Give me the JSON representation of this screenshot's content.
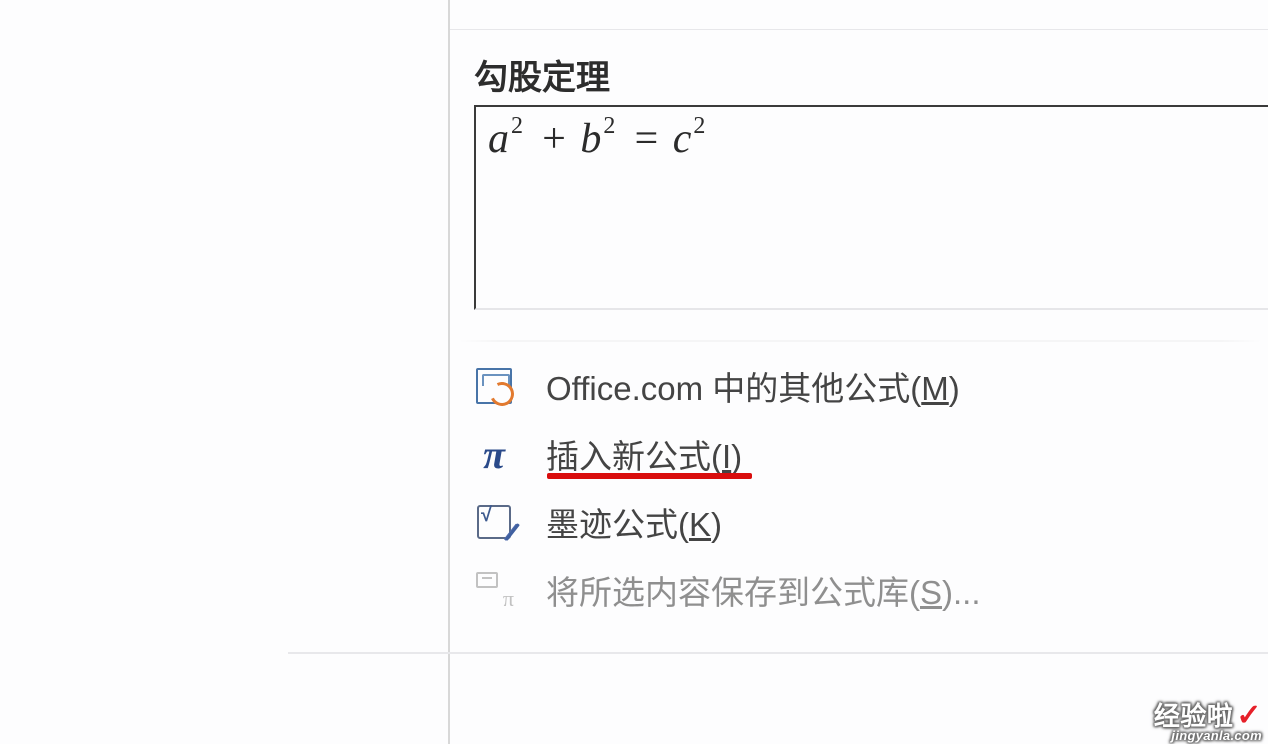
{
  "gallery": {
    "section_title": "勾股定理",
    "equation_html": "<i>a</i><sup>2</sup> + <i>b</i><sup>2</sup> = <i>c</i><sup>2</sup>"
  },
  "menu": {
    "office": {
      "label_pre": "Office.com 中的其他公式(",
      "hotkey": "M",
      "label_post": ")"
    },
    "insert": {
      "label_pre": "插入新公式(",
      "hotkey": "I",
      "label_post": ")"
    },
    "ink": {
      "label_pre": "墨迹公式(",
      "hotkey": "K",
      "label_post": ")"
    },
    "save": {
      "label_pre": "将所选内容保存到公式库(",
      "hotkey": "S",
      "label_post": ")..."
    }
  },
  "watermark": {
    "line1": "经验啦",
    "check": "✓",
    "line2": "jingyanla.com"
  }
}
